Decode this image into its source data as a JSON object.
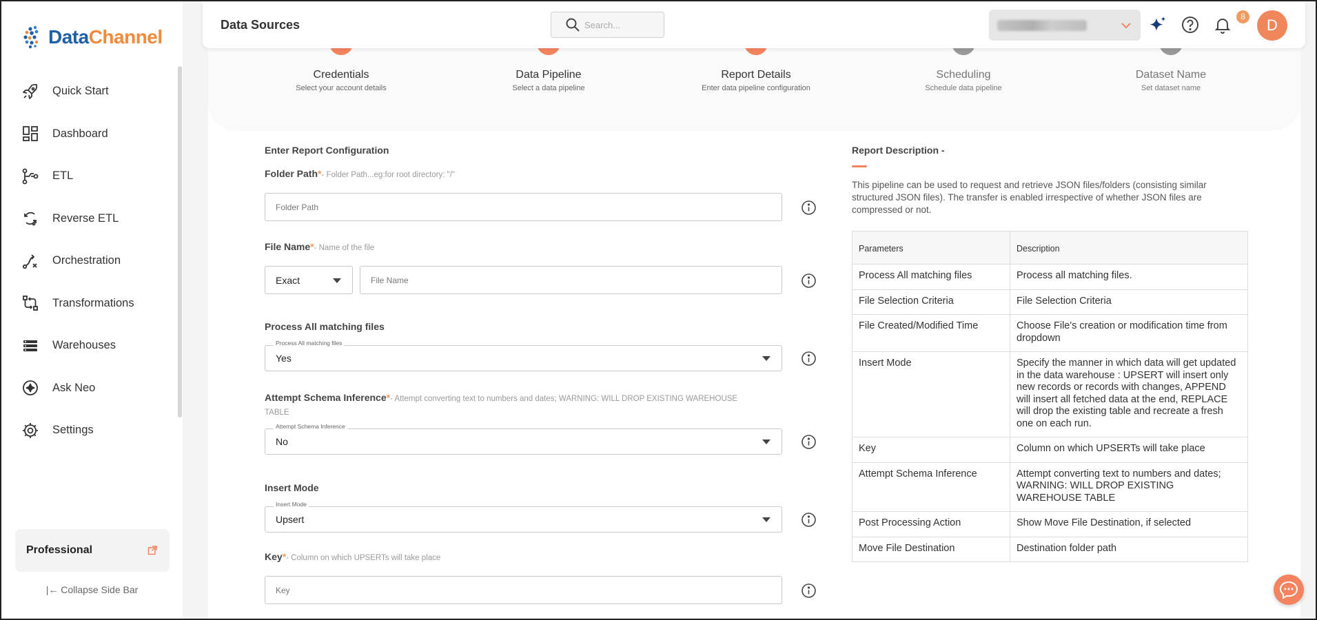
{
  "app": {
    "logo_part1": "Data",
    "logo_part2": "Channel"
  },
  "sidebar": {
    "items": [
      {
        "label": "Quick Start",
        "icon": "rocket-icon"
      },
      {
        "label": "Dashboard",
        "icon": "dashboard-icon"
      },
      {
        "label": "ETL",
        "icon": "etl-icon"
      },
      {
        "label": "Reverse ETL",
        "icon": "reverse-etl-icon"
      },
      {
        "label": "Orchestration",
        "icon": "orchestration-icon"
      },
      {
        "label": "Transformations",
        "icon": "transformations-icon"
      },
      {
        "label": "Warehouses",
        "icon": "warehouse-icon"
      },
      {
        "label": "Ask Neo",
        "icon": "sparkle-icon"
      },
      {
        "label": "Settings",
        "icon": "gear-icon"
      }
    ],
    "plan": "Professional",
    "collapse_label": "Collapse Side Bar"
  },
  "header": {
    "title": "Data Sources",
    "search_placeholder": "Search...",
    "notification_count": "8",
    "avatar_initial": "D"
  },
  "steps": [
    {
      "title": "Credentials",
      "subtitle": "Select your account details",
      "status": "done"
    },
    {
      "title": "Data Pipeline",
      "subtitle": "Select a data pipeline",
      "status": "done"
    },
    {
      "title": "Report Details",
      "subtitle": "Enter data pipeline configuration",
      "status": "done"
    },
    {
      "title": "Scheduling",
      "subtitle": "Schedule data pipeline",
      "status": "todo"
    },
    {
      "title": "Dataset Name",
      "subtitle": "Set dataset name",
      "status": "todo"
    }
  ],
  "form": {
    "heading": "Enter Report Configuration",
    "folder_path": {
      "label": "Folder Path",
      "req": "*",
      "hint": "- Folder Path...eg:for root directory: \"/\"",
      "placeholder": "Folder Path"
    },
    "file_name": {
      "label": "File Name",
      "req": "*",
      "hint": "- Name of the file",
      "match_value": "Exact",
      "placeholder": "File Name"
    },
    "process_all": {
      "label": "Process All matching files",
      "float_label": "Process All matching files",
      "value": "Yes"
    },
    "schema_inference": {
      "label": "Attempt Schema Inference",
      "req": "*",
      "hint": "- Attempt converting text to numbers and dates; WARNING: WILL DROP EXISTING WAREHOUSE TABLE",
      "float_label": "Attempt Schema Inference",
      "value": "No"
    },
    "insert_mode": {
      "label": "Insert Mode",
      "float_label": "Insert Mode",
      "value": "Upsert"
    },
    "key": {
      "label": "Key",
      "req": "*",
      "hint": "- Column on which UPSERTs will take place",
      "placeholder": "Key"
    }
  },
  "description": {
    "title": "Report Description -",
    "text": "This pipeline can be used to request and retrieve JSON files/folders (consisting similar structured JSON files). The transfer is enabled irrespective of whether JSON files are compressed or not.",
    "table_headers": [
      "Parameters",
      "Description"
    ],
    "rows": [
      [
        "Process All matching files",
        "Process all matching files."
      ],
      [
        "File Selection Criteria",
        "File Selection Criteria"
      ],
      [
        "File Created/Modified Time",
        "Choose File's creation or modification time from dropdown"
      ],
      [
        "Insert Mode",
        "Specify the manner in which data will get updated in the data warehouse : UPSERT will insert only new records or records with changes, APPEND will insert all fetched data at the end, REPLACE will drop the existing table and recreate a fresh one on each run."
      ],
      [
        "Key",
        "Column on which UPSERTs will take place"
      ],
      [
        "Attempt Schema Inference",
        "Attempt converting text to numbers and dates; WARNING: WILL DROP EXISTING WAREHOUSE TABLE"
      ],
      [
        "Post Processing Action",
        "Show Move File Destination, if selected"
      ],
      [
        "Move File Destination",
        "Destination folder path"
      ]
    ]
  },
  "colors": {
    "accent": "#f4845f",
    "brand_blue": "#1f5fa8",
    "brand_orange": "#f08a3c"
  }
}
